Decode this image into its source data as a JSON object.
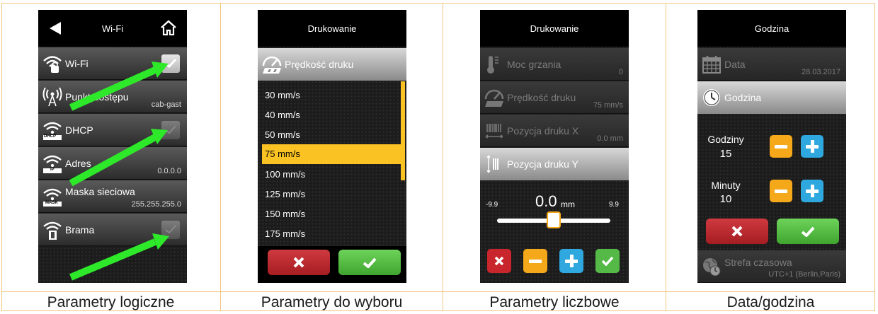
{
  "captions": [
    "Parametry logiczne",
    "Parametry do wyboru",
    "Parametry liczbowe",
    "Data/godzina"
  ],
  "screen1": {
    "title": "Wi-Fi",
    "rows": [
      {
        "label": "Wi-Fi",
        "value": "",
        "checked": true
      },
      {
        "label": "Punkt dostępu",
        "value": "cab-gast"
      },
      {
        "label": "DHCP",
        "value": "",
        "checked": false,
        "badge": "DHCP"
      },
      {
        "label": "Adres",
        "value": "0.0.0.0",
        "badge": "IP"
      },
      {
        "label": "Maska sieciowa",
        "value": "255.255.255.0",
        "badge": "MASK"
      },
      {
        "label": "Brama",
        "value": "",
        "checked": false
      }
    ]
  },
  "screen2": {
    "title": "Drukowanie",
    "header": "Prędkość druku",
    "options": [
      "30 mm/s",
      "40 mm/s",
      "50 mm/s",
      "75 mm/s",
      "100 mm/s",
      "125 mm/s",
      "150 mm/s",
      "175 mm/s"
    ],
    "selected_index": 3
  },
  "screen3": {
    "title": "Drukowanie",
    "rows": [
      {
        "label": "Moc grzania",
        "value": "0"
      },
      {
        "label": "Prędkość druku",
        "value": "75 mm/s"
      },
      {
        "label": "Pozycja druku X",
        "value": "0.0 mm"
      }
    ],
    "active_label": "Pozycja druku Y",
    "min": "-9.9",
    "max": "9.9",
    "value": "0.0",
    "unit": "mm",
    "slider_fraction": 0.5
  },
  "screen4": {
    "title": "Godzina",
    "date_label": "Data",
    "date_value": "28.03.2017",
    "time_label": "Godzina",
    "hours_label": "Godziny",
    "hours_value": "15",
    "minutes_label": "Minuty",
    "minutes_value": "10",
    "tz_label": "Strefa czasowa",
    "tz_value": "UTC+1 (Berlin,Paris)"
  },
  "colors": {
    "accent": "#fbc223",
    "arrow": "#2ee82a",
    "border": "#f1c580"
  }
}
